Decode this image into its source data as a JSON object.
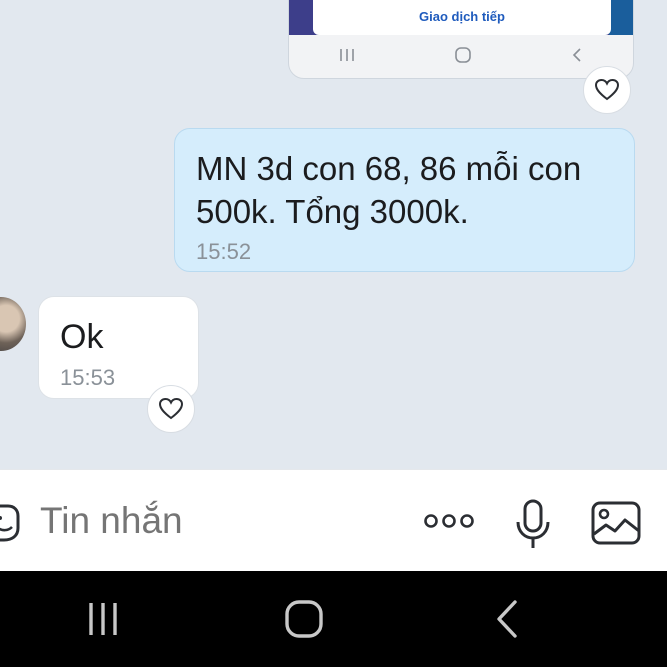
{
  "messages": {
    "image_message": {
      "button_text": "Giao dịch tiếp"
    },
    "sent": {
      "text": "MN 3d con 68, 86 mỗi con 500k. Tổng 3000k.",
      "time": "15:52"
    },
    "received": {
      "text": "Ok",
      "time": "15:53"
    }
  },
  "composer": {
    "placeholder": "Tin nhắn",
    "icons": [
      "sticker-icon",
      "more-options-icon",
      "microphone-icon",
      "gallery-icon"
    ]
  },
  "system_nav": {
    "icons": [
      "recent-apps-icon",
      "home-icon",
      "back-icon"
    ]
  },
  "colors": {
    "chat_background": "#e2e8ef",
    "sent_bubble": "#d5edfc",
    "received_bubble": "#ffffff",
    "accent_blue": "#1f5bbd"
  }
}
